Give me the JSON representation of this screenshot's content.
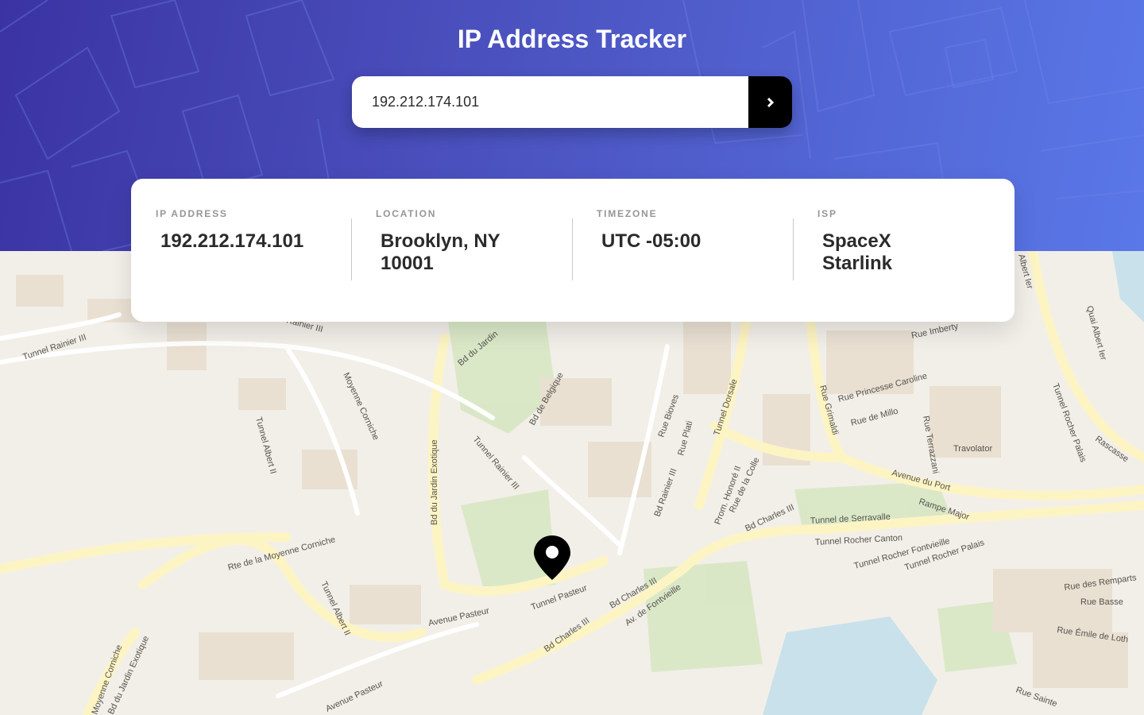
{
  "header": {
    "title": "IP Address Tracker",
    "search": {
      "value": "192.212.174.101",
      "submit_icon": "chevron-right-icon"
    }
  },
  "info": {
    "ip_address": {
      "label": "IP ADDRESS",
      "value": "192.212.174.101"
    },
    "location": {
      "label": "LOCATION",
      "value": "Brooklyn, NY 10001"
    },
    "timezone": {
      "label": "TIMEZONE",
      "value": "UTC -05:00"
    },
    "isp": {
      "label": "ISP",
      "value": "SpaceX Starlink"
    }
  },
  "map": {
    "marker_icon": "location-pin-icon",
    "street_labels": [
      "Tunnel Rainier III",
      "Rainier III",
      "Bd du Jardin",
      "Bd de Belgique",
      "Moyenne Corniche",
      "Tunnel Albert II",
      "Bd du Jardin Exotique",
      "Tunnel Rainier III",
      "Rue Bioves",
      "Rue Plati",
      "Bd Rainier III",
      "Tunnel Dorsale",
      "Rue Grimaldi",
      "Rue Imberty",
      "Rue Princesse Caroline",
      "Rue de Millo",
      "Rue Terrazzani",
      "Travolator",
      "Tunnel Rocher Palais",
      "Rascasse",
      "Avenue du Port",
      "Rampe Major",
      "Rue de la Colle",
      "Prom. Honoré II",
      "Bd Charles III",
      "Tunnel de Serravalle",
      "Tunnel Rocher Canton",
      "Tunnel Rocher Fontvieille",
      "Tunnel Rocher Palais",
      "Tunnel Albert II",
      "Rte de la Moyenne Corniche",
      "Tunnel Pasteur",
      "Avenue Pasteur",
      "Bd Charles III",
      "Av. de Fontvieille",
      "Bd Charles III",
      "Avenue Pasteur",
      "Moyenne Corniche",
      "Bd du Jardin Exotique",
      "Rue des Remparts",
      "Rue Basse",
      "Rue Émile de Loth",
      "Rue Sainte",
      "Quai Albert Ier",
      "Albert Ier"
    ]
  },
  "colors": {
    "header_gradient_start": "#3b33a3",
    "header_gradient_end": "#5a78e8",
    "button": "#000000",
    "map_land": "#f2efe9",
    "map_road": "#fdf4c4",
    "map_park": "#d6e6c2",
    "map_water": "#c9e1ea"
  }
}
